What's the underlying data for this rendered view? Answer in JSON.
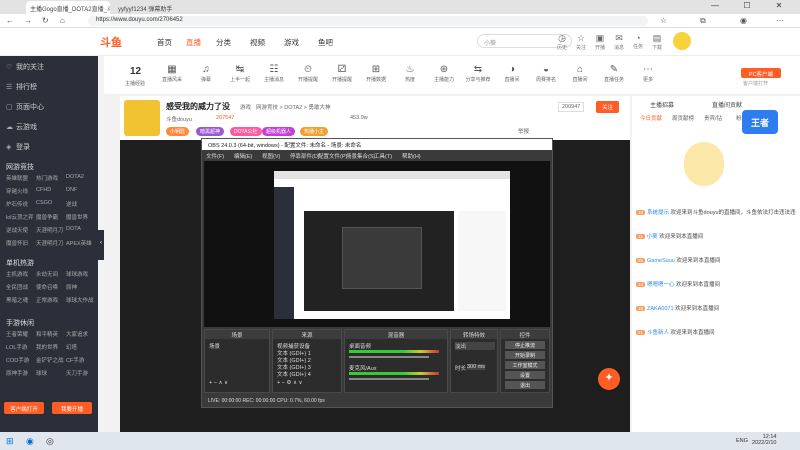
{
  "browser": {
    "tabs": [
      {
        "title": "主播Gogo直播_DOTA2直播_斗鱼"
      },
      {
        "title": "yyfyyf1234 弹幕助手"
      }
    ],
    "url": "https://www.douyu.com/2706452",
    "window_controls": {
      "min": "—",
      "max": "☐",
      "close": "✕"
    }
  },
  "site": {
    "logo": "斗鱼",
    "nav": [
      "首页",
      "直播",
      "分类",
      "视频",
      "游戏",
      "鱼吧"
    ],
    "active_nav": "直播",
    "search_placeholder": "小葵",
    "header_icons": [
      {
        "glyph": "◷",
        "label": "历史"
      },
      {
        "glyph": "☆",
        "label": "关注"
      },
      {
        "glyph": "▣",
        "label": "开播"
      },
      {
        "glyph": "✉",
        "label": "消息"
      },
      {
        "glyph": "◔",
        "label": "任务"
      },
      {
        "glyph": "▤",
        "label": "下载"
      },
      {
        "glyph": "⚙",
        "label": "会员中心"
      }
    ]
  },
  "sidebar": {
    "items": [
      {
        "glyph": "♡",
        "label": "我的关注"
      },
      {
        "glyph": "☰",
        "label": "排行榜"
      },
      {
        "glyph": "▢",
        "label": "页面中心"
      },
      {
        "glyph": "☁",
        "label": "云游戏"
      },
      {
        "glyph": "◈",
        "label": "登录"
      }
    ],
    "section_online": "网游竞技",
    "online_games": [
      "英雄联盟",
      "热门游戏",
      "DOTA2",
      "穿越火线",
      "CFHD",
      "DNF",
      "炉石传说",
      "CSGO",
      "逆战",
      "lol云顶之弈",
      "魔兽争霸",
      "魔兽世界",
      "逆战天使",
      "天涯明月刀",
      "DOTA",
      "魔兽怀旧",
      "天涯明月刀",
      "APEX英雄"
    ],
    "section_single": "单机热游",
    "single_games": [
      "主机游戏",
      "永劫无间",
      "球球游戏",
      "全民团战",
      "使命召唤",
      "原神",
      "黑暗之魂",
      "正常游戏",
      "球球大作战"
    ],
    "section_mobile": "手游休闲",
    "mobile_games": [
      "王者荣耀",
      "和平精英",
      "大家追求",
      "LOL手游",
      "我的世界",
      "幻塔",
      "COD手游",
      "金铲铲之战",
      "CF手游",
      "原神手游",
      "球球",
      "天刀手游"
    ],
    "btn_download": "客户端打开",
    "btn_live": "我要开播"
  },
  "toolbar": {
    "level_num": "12",
    "level_label": "主播经验",
    "items": [
      {
        "glyph": "▦",
        "label": "直播风采"
      },
      {
        "glyph": "♫",
        "label": "弹幕"
      },
      {
        "glyph": "↹",
        "label": "上半一起"
      },
      {
        "glyph": "☷",
        "label": "主播消息"
      },
      {
        "glyph": "⏲",
        "label": "开播提醒"
      },
      {
        "glyph": "⚂",
        "label": "开播提醒"
      },
      {
        "glyph": "⊞",
        "label": "开播数据"
      },
      {
        "glyph": "♨",
        "label": "热度"
      },
      {
        "glyph": "⊛",
        "label": "主播能力"
      },
      {
        "glyph": "⇆",
        "label": "分享与推荐"
      },
      {
        "glyph": "◑",
        "label": "直播间"
      },
      {
        "glyph": "◒",
        "label": "周赛排名"
      },
      {
        "glyph": "⌂",
        "label": "直播间"
      },
      {
        "glyph": "✎",
        "label": "直播任务"
      },
      {
        "glyph": "⋯",
        "label": "更多"
      }
    ],
    "pc_label": "PC客户端",
    "pc_sub": "客户端打开"
  },
  "stream": {
    "title": "感受我的威力了没",
    "category": "游戏",
    "sub": "网游竞技 > DOTA2 > 勇敢大神",
    "streamer": "斗鱼douyu",
    "heat": "207547",
    "tags": [
      "小钥匙",
      "暗黑超神",
      "DOTA公社",
      "超级机器人",
      "热播小主"
    ],
    "followers": "453.9w",
    "report": "举报",
    "follow_count": "200947",
    "follow_btn": "关注"
  },
  "obs": {
    "title": "OBS 24.0.3 (64-bit, windows) - 配置文件: 未命名 - 场景: 未命名",
    "menu": [
      "文件(F)",
      "编辑(E)",
      "视图(V)",
      "停靠部件(D)",
      "配置文件(P)",
      "场景集合(S)",
      "工具(T)",
      "帮助(H)"
    ],
    "docks": {
      "scenes": "场景",
      "sources": "来源",
      "mixer": "混音器",
      "transitions": "转场特效",
      "controls": "控件"
    },
    "scene_item": "场景",
    "sources": [
      "视频捕获设备",
      "文本 (GDI+) 1",
      "文本 (GDI+) 2",
      "文本 (GDI+) 3",
      "文本 (GDI+) 4"
    ],
    "mixer": [
      "桌面音频",
      "麦克风/Aux"
    ],
    "transition": "淡出",
    "duration_label": "时长",
    "duration": "300 ms",
    "controls": [
      "停止推流",
      "开始录制",
      "工作室模式",
      "设置",
      "退出"
    ],
    "status": "LIVE: 00:00:00   REC: 00:00:00   CPU: 0.7%, 60.00 fps"
  },
  "rightpanel": {
    "head": [
      "主播招募",
      "直播间贡献"
    ],
    "tabs": [
      "今日贡献",
      "周贡献榜",
      "贵宾/钻",
      "粉丝榜"
    ],
    "chat": [
      {
        "lv": "19",
        "name": "系统提示",
        "text": "欢迎来到斗鱼douyu的直播间，斗鱼依法打击违法违规行为"
      },
      {
        "lv": "11",
        "name": "小葵",
        "text": "欢迎来到本直播间"
      },
      {
        "lv": "26",
        "name": "GameSuuu",
        "text": "欢迎来到本直播间"
      },
      {
        "lv": "14",
        "name": "嗯嗯嗯一心",
        "text": "欢迎来到本直播间"
      },
      {
        "lv": "18",
        "name": "ZAKA0071",
        "text": "欢迎来到本直播间"
      },
      {
        "lv": "21",
        "name": "斗鱼新人",
        "text": "欢迎来到本直播间"
      }
    ]
  },
  "taskbar": {
    "time": "12:14",
    "date": "2022/2/10",
    "lang": "ENG"
  },
  "colors": {
    "brand": "#ff5d23",
    "sidebar": "#2b2f3a",
    "obs_bg": "#3a3a3a"
  }
}
